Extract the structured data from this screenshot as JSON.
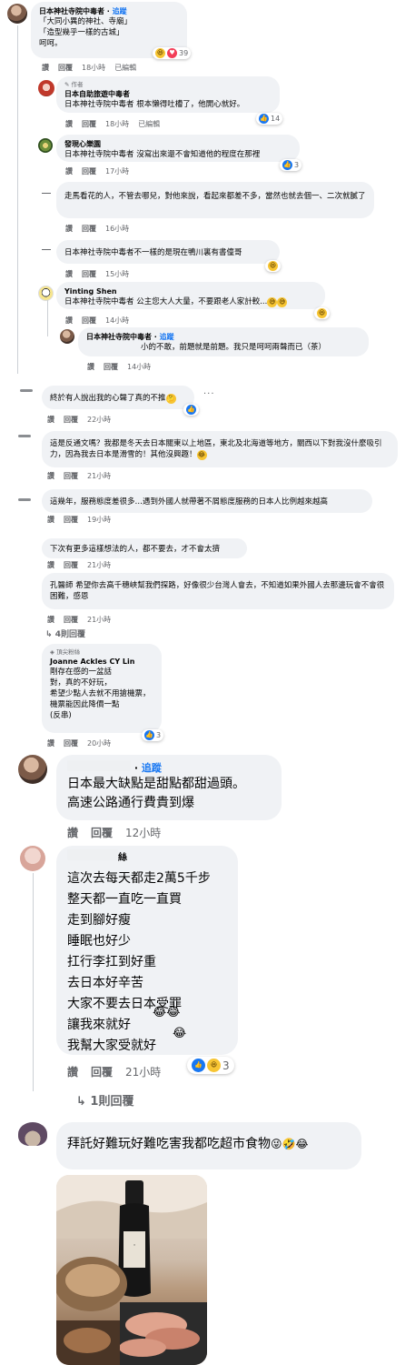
{
  "actions": {
    "like": "讚",
    "reply": "回覆",
    "edited": "已編輯"
  },
  "comments": {
    "c1": {
      "name": "日本神社寺院中毒者",
      "follow": "追蹤",
      "text": "「大同小異的神社、寺廟」\n「造型幾乎一樣的古城」\n呵呵。",
      "time": "18小時",
      "reactions": "39"
    },
    "c1r1": {
      "badge": "作者",
      "name": "日本自助旅遊中毒者",
      "text": "日本神社寺院中毒者 根本懶得吐槽了，他開心就好。",
      "time": "18小時",
      "reactions": "14"
    },
    "c1r2": {
      "name": "發現心樂園",
      "text": "日本神社寺院中毒者 沒寫出來還不會知道他的程度在那裡",
      "time": "17小時",
      "reactions": "3"
    },
    "c1r3": {
      "text": "走馬看花的人，不管去哪兒，對他來說，看起來都差不多，當然也就去個一、二次就膩了",
      "time": "16小時"
    },
    "c1r4": {
      "text": "日本神社寺院中毒者不一樣的是現在鴨川裏有書僮哥",
      "time": "15小時"
    },
    "c1r5": {
      "name": "Yinting Shen",
      "text": "日本神社寺院中毒者 公主您大人大量，不要跟老人家計較...",
      "time": "14小時"
    },
    "c1r6": {
      "name": "日本神社寺院中毒者",
      "follow": "追蹤",
      "text": "小的不敢，前題就是前題。我只是呵呵兩聲而已（茶）",
      "time": "14小時"
    },
    "c2": {
      "text": "終於有人說出我的心聲了真的不推",
      "time": "22小時",
      "more": "···"
    },
    "c3": {
      "text": "這是反通文嗎？我都是冬天去日本關東以上地區，東北及北海道等地方，關西以下對我沒什麼吸引力，因為我去日本是滑雪的！其他沒興趣！",
      "time": "21小時"
    },
    "c4": {
      "text": "這幾年，服務態度差很多…遇到外國人就帶著不屑態度服務的日本人比例越來越高",
      "time": "19小時"
    },
    "c5": {
      "text": "下次有更多這樣想法的人，都不要去，才不會太擠",
      "time": "21小時"
    },
    "c6": {
      "text": "孔醫師 希望你去高千穗峽幫我們探路，好像很少台灣人會去，不知道如果外國人去那邊玩會不會很困難，感恩",
      "time": "21小時",
      "replies": "4則回覆"
    },
    "c6r1": {
      "badge": "頂尖粉絲",
      "name": "Joanne Ackles CY Lin",
      "text": "剛存在感的一盆話\n對，真的不好玩，\n希望少點人去就不用搶機票，\n機票能因此降價一點\n(反串)",
      "time": "20小時",
      "reactions": "3"
    },
    "c7": {
      "follow": "追蹤",
      "text": "日本最大缺點是甜點都甜過頭。\n高速公路通行費貴到爆",
      "time": "12小時"
    },
    "c8": {
      "name_tail": "絲",
      "text": "這次去每天都走2萬5千步\n整天都一直吃一直買\n走到腳好瘦\n睡眠也好少\n扛行李扛到好重\n去日本好辛苦\n大家不要去日本受罪\n讓我來就好\n我幫大家受就好",
      "time": "21小時",
      "reactions": "3",
      "replies": "1則回覆"
    },
    "c9": {
      "text": "拜託好難玩好難吃害我都吃超市食物"
    }
  }
}
